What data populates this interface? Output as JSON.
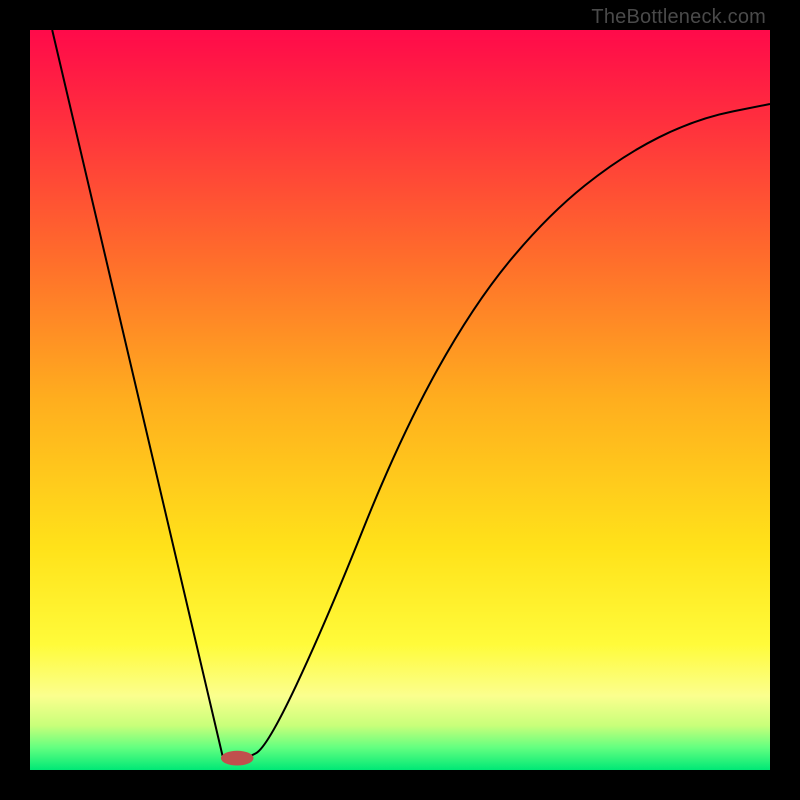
{
  "watermark": "TheBottleneck.com",
  "chart_data": {
    "type": "line",
    "title": "",
    "xlabel": "",
    "ylabel": "",
    "xlim": [
      0,
      100
    ],
    "ylim": [
      0,
      100
    ],
    "gradient_stops": [
      {
        "pct": 0,
        "color": "#ff0a4a"
      },
      {
        "pct": 12,
        "color": "#ff2e3e"
      },
      {
        "pct": 30,
        "color": "#ff6a2c"
      },
      {
        "pct": 50,
        "color": "#ffae1e"
      },
      {
        "pct": 70,
        "color": "#ffe21a"
      },
      {
        "pct": 83,
        "color": "#fffb3a"
      },
      {
        "pct": 90,
        "color": "#fbff8e"
      },
      {
        "pct": 94,
        "color": "#c8ff7a"
      },
      {
        "pct": 97,
        "color": "#62ff80"
      },
      {
        "pct": 100,
        "color": "#00e876"
      }
    ],
    "series": [
      {
        "name": "bottleneck-curve",
        "points": [
          {
            "x": 3,
            "y": 100
          },
          {
            "x": 26,
            "y": 2
          },
          {
            "x": 29,
            "y": 1.5
          },
          {
            "x": 32,
            "y": 3
          },
          {
            "x": 40,
            "y": 20
          },
          {
            "x": 50,
            "y": 45
          },
          {
            "x": 60,
            "y": 63
          },
          {
            "x": 70,
            "y": 75
          },
          {
            "x": 80,
            "y": 83
          },
          {
            "x": 90,
            "y": 88
          },
          {
            "x": 100,
            "y": 90
          }
        ]
      }
    ],
    "marker": {
      "x": 28,
      "y": 1.6,
      "rx": 2.2,
      "ry": 1.0,
      "color": "#c0504d"
    }
  }
}
